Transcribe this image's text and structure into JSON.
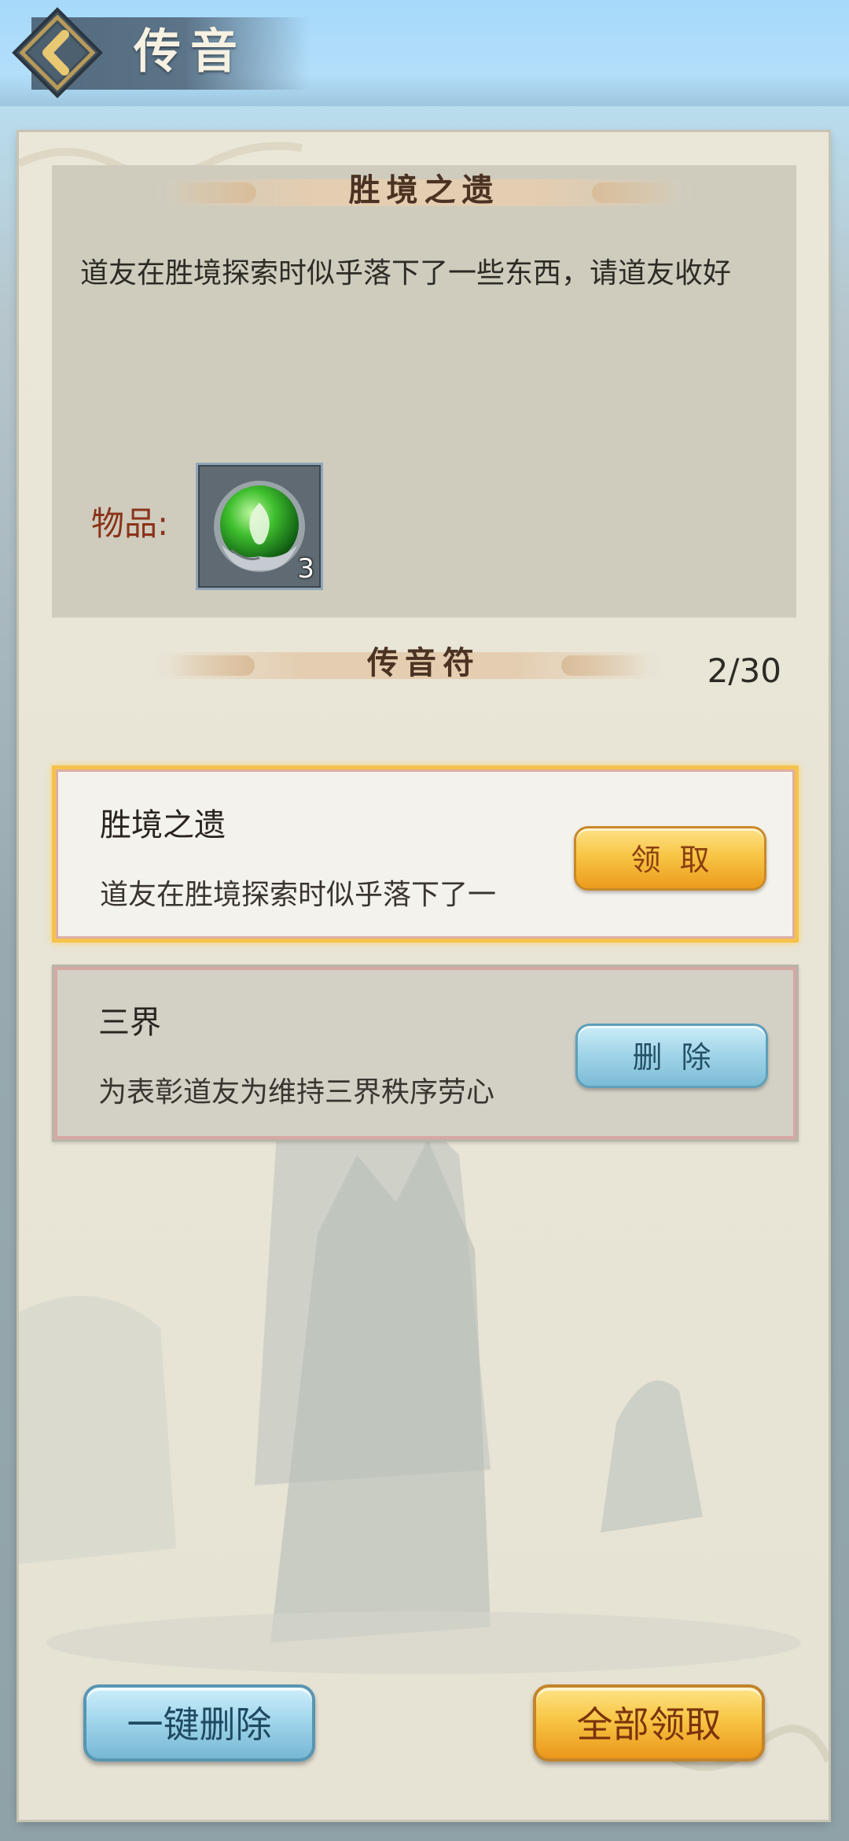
{
  "header": {
    "title": "传音"
  },
  "detail": {
    "title": "胜境之遗",
    "body": "道友在胜境探索时似乎落下了一些东西，请道友收好",
    "items_label": "物品:",
    "items": [
      {
        "icon": "green-leaf-orb-icon",
        "count": "3"
      }
    ]
  },
  "list": {
    "title": "传音符",
    "counter": "2/30",
    "mails": [
      {
        "title": "胜境之遗",
        "preview": "道友在胜境探索时似乎落下了一",
        "action": "领取",
        "selected": true
      },
      {
        "title": "三界",
        "preview": "为表彰道友为维持三界秩序劳心",
        "action": "删除",
        "selected": false
      }
    ]
  },
  "footer": {
    "delete_all": "一键删除",
    "claim_all": "全部领取"
  },
  "colors": {
    "header_sky": "#a6d9fa",
    "panel_bg": "#eae6d8",
    "gold_button": "#f8c545",
    "blue_button": "#9fd3e8",
    "selected_border": "#f7c24a",
    "items_label": "#8b3319"
  }
}
